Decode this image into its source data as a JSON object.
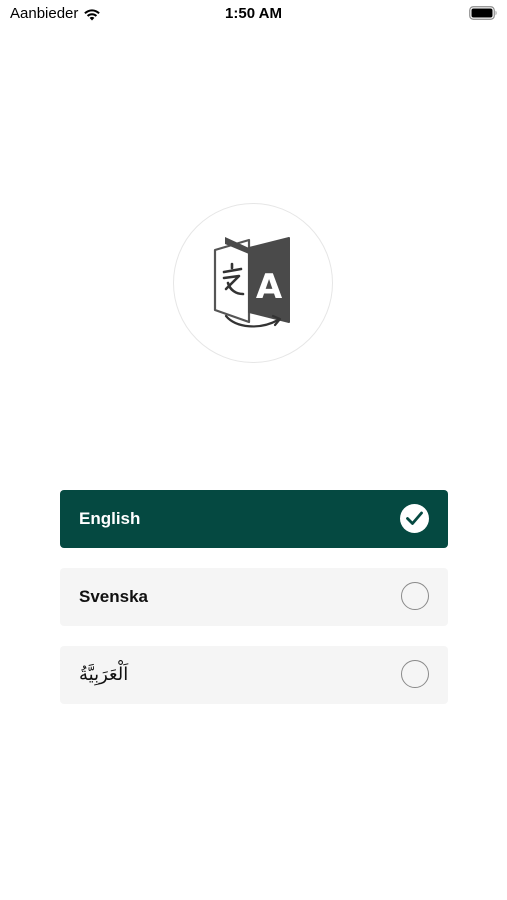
{
  "status_bar": {
    "carrier": "Aanbieder",
    "time": "1:50 AM",
    "wifi_icon": "wifi-icon",
    "battery_icon": "battery-icon"
  },
  "logo": {
    "icon": "translate-icon",
    "glyph_left": "文",
    "glyph_right": "A"
  },
  "languages": [
    {
      "label": "English",
      "selected": true
    },
    {
      "label": "Svenska",
      "selected": false
    },
    {
      "label": "اَلْعَرَبِيَّةُ",
      "selected": false
    }
  ],
  "colors": {
    "selected_bg": "#054941",
    "option_bg": "#f5f5f5"
  }
}
